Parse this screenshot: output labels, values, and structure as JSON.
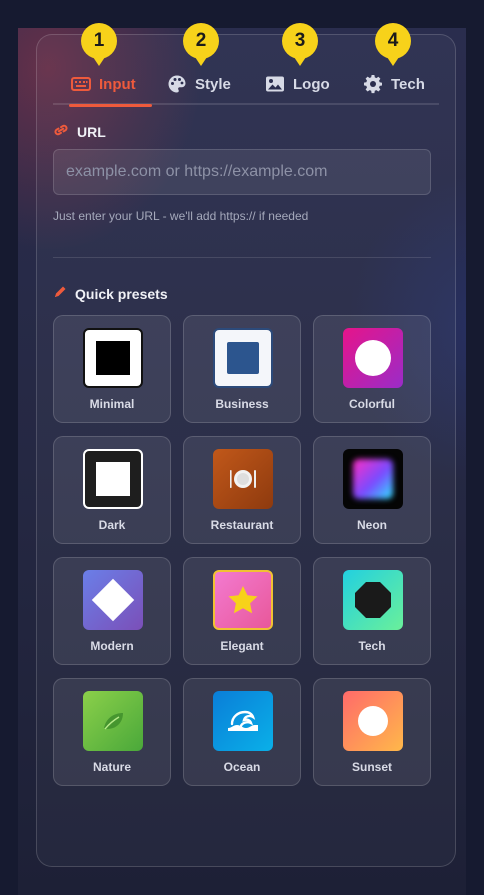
{
  "tabs": [
    {
      "label": "Input",
      "icon": "keyboard-icon",
      "step": "1",
      "active": true
    },
    {
      "label": "Style",
      "icon": "palette-icon",
      "step": "2",
      "active": false
    },
    {
      "label": "Logo",
      "icon": "image-icon",
      "step": "3",
      "active": false
    },
    {
      "label": "Tech",
      "icon": "gear-icon",
      "step": "4",
      "active": false
    }
  ],
  "url_section": {
    "label": "URL",
    "icon": "link-icon",
    "placeholder": "example.com or https://example.com",
    "value": "",
    "hint": "Just enter your URL - we'll add https:// if needed"
  },
  "presets_section": {
    "label": "Quick presets",
    "icon": "pencil-icon",
    "items": [
      {
        "label": "Minimal",
        "icon": "minimal-preset-icon"
      },
      {
        "label": "Business",
        "icon": "business-preset-icon"
      },
      {
        "label": "Colorful",
        "icon": "colorful-preset-icon"
      },
      {
        "label": "Dark",
        "icon": "dark-preset-icon"
      },
      {
        "label": "Restaurant",
        "icon": "restaurant-preset-icon"
      },
      {
        "label": "Neon",
        "icon": "neon-preset-icon"
      },
      {
        "label": "Modern",
        "icon": "modern-preset-icon"
      },
      {
        "label": "Elegant",
        "icon": "elegant-preset-icon"
      },
      {
        "label": "Tech",
        "icon": "tech-preset-icon"
      },
      {
        "label": "Nature",
        "icon": "nature-preset-icon"
      },
      {
        "label": "Ocean",
        "icon": "ocean-preset-icon"
      },
      {
        "label": "Sunset",
        "icon": "sunset-preset-icon"
      }
    ]
  },
  "colors": {
    "accent": "#ee5a3c",
    "badge": "#f7d21a",
    "panel_bg": "#252843"
  }
}
